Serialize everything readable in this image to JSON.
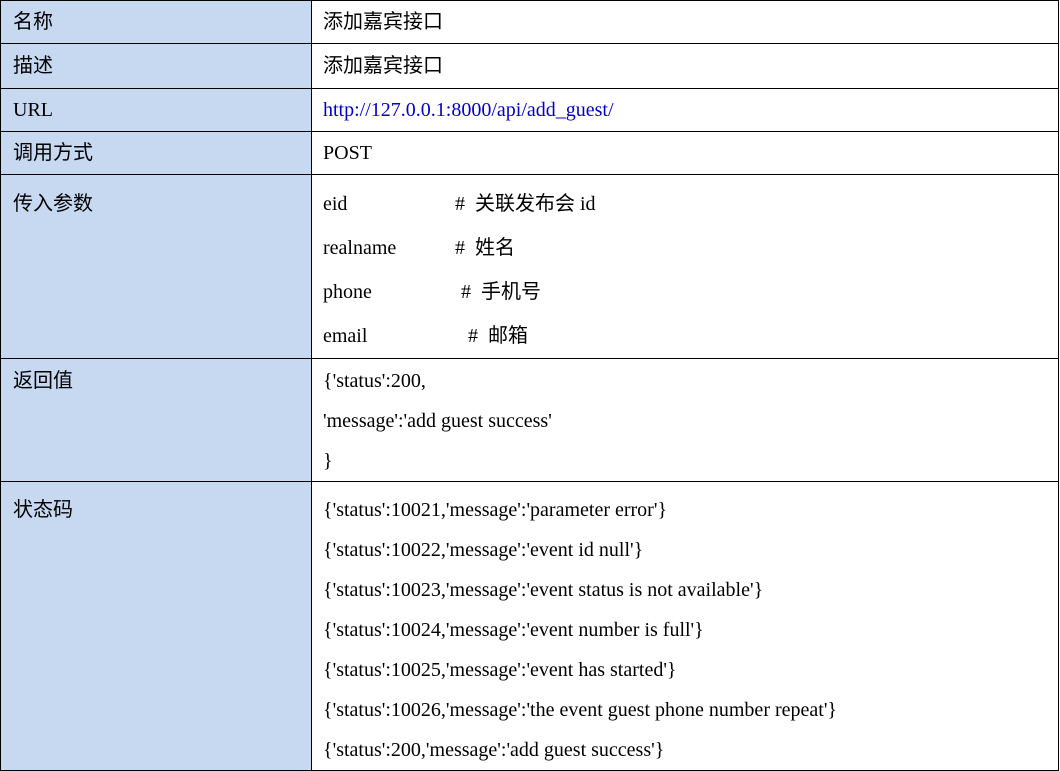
{
  "rows": {
    "name": {
      "label": "名称",
      "value": "添加嘉宾接口"
    },
    "description": {
      "label": "描述",
      "value": "添加嘉宾接口"
    },
    "url": {
      "label": "URL",
      "value": "http://127.0.0.1:8000/api/add_guest/"
    },
    "method": {
      "label": "调用方式",
      "value": "POST"
    },
    "params": {
      "label": "传入参数",
      "items": [
        {
          "name": "eid",
          "comment": "#  关联发布会 id"
        },
        {
          "name": "realname",
          "comment": "#  姓名"
        },
        {
          "name": "phone",
          "comment": "#  手机号"
        },
        {
          "name": "email",
          "comment": "#  邮箱"
        }
      ]
    },
    "return_value": {
      "label": "返回值",
      "lines": [
        "{'status':200,",
        "'message':'add guest success'",
        "}"
      ]
    },
    "status_codes": {
      "label": "状态码",
      "lines": [
        "{'status':10021,'message':'parameter error'}",
        "{'status':10022,'message':'event id null'}",
        "{'status':10023,'message':'event status is not available'}",
        "{'status':10024,'message':'event number is full'}",
        "{'status':10025,'message':'event has started'}",
        "{'status':10026,'message':'the event guest phone number repeat'}",
        "{'status':200,'message':'add guest success'}"
      ]
    }
  },
  "colors": {
    "label_background": "#c6d9f1",
    "link": "#0000cc",
    "border": "#000000"
  }
}
